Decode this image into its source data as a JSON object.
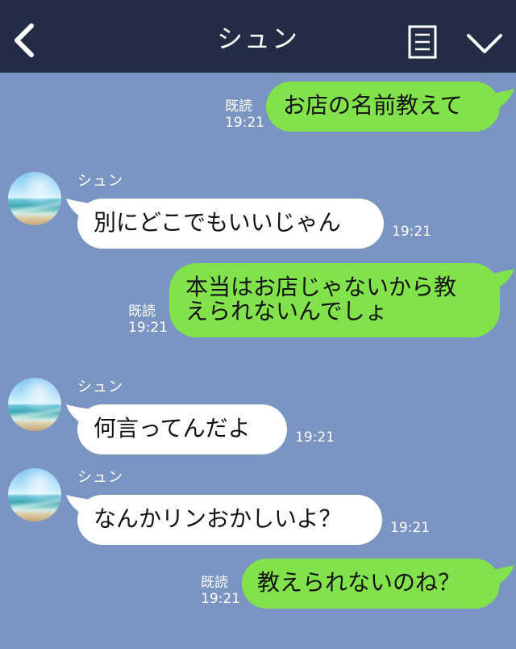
{
  "header": {
    "title": "シュン",
    "back_icon": "chevron-left-icon",
    "menu_icon": "note-menu-icon",
    "more_icon": "chevron-down-icon"
  },
  "messages": [
    {
      "side": "outgoing",
      "read": "既読",
      "time": "19:21",
      "text": "お店の名前教えて"
    },
    {
      "side": "incoming",
      "sender": "シュン",
      "avatar": "beach-avatar",
      "text": "別にどこでもいいじゃん",
      "time": "19:21"
    },
    {
      "side": "outgoing",
      "read": "既読",
      "time": "19:21",
      "lines": [
        "本当はお店じゃないから教",
        "えられないんでしょ"
      ]
    },
    {
      "side": "incoming",
      "sender": "シュン",
      "avatar": "beach-avatar",
      "text": "何言ってんだよ",
      "time": "19:21"
    },
    {
      "side": "incoming",
      "sender": "シュン",
      "avatar": "beach-avatar",
      "text": "なんかリンおかしいよ？",
      "time": "19:21"
    },
    {
      "side": "outgoing",
      "read": "既読",
      "time": "19:21",
      "text": "教えられないのね？"
    }
  ],
  "colors": {
    "background": "#7a95c2",
    "header": "#222c44",
    "outgoing_bubble": "#82e24b",
    "incoming_bubble": "#ffffff"
  }
}
